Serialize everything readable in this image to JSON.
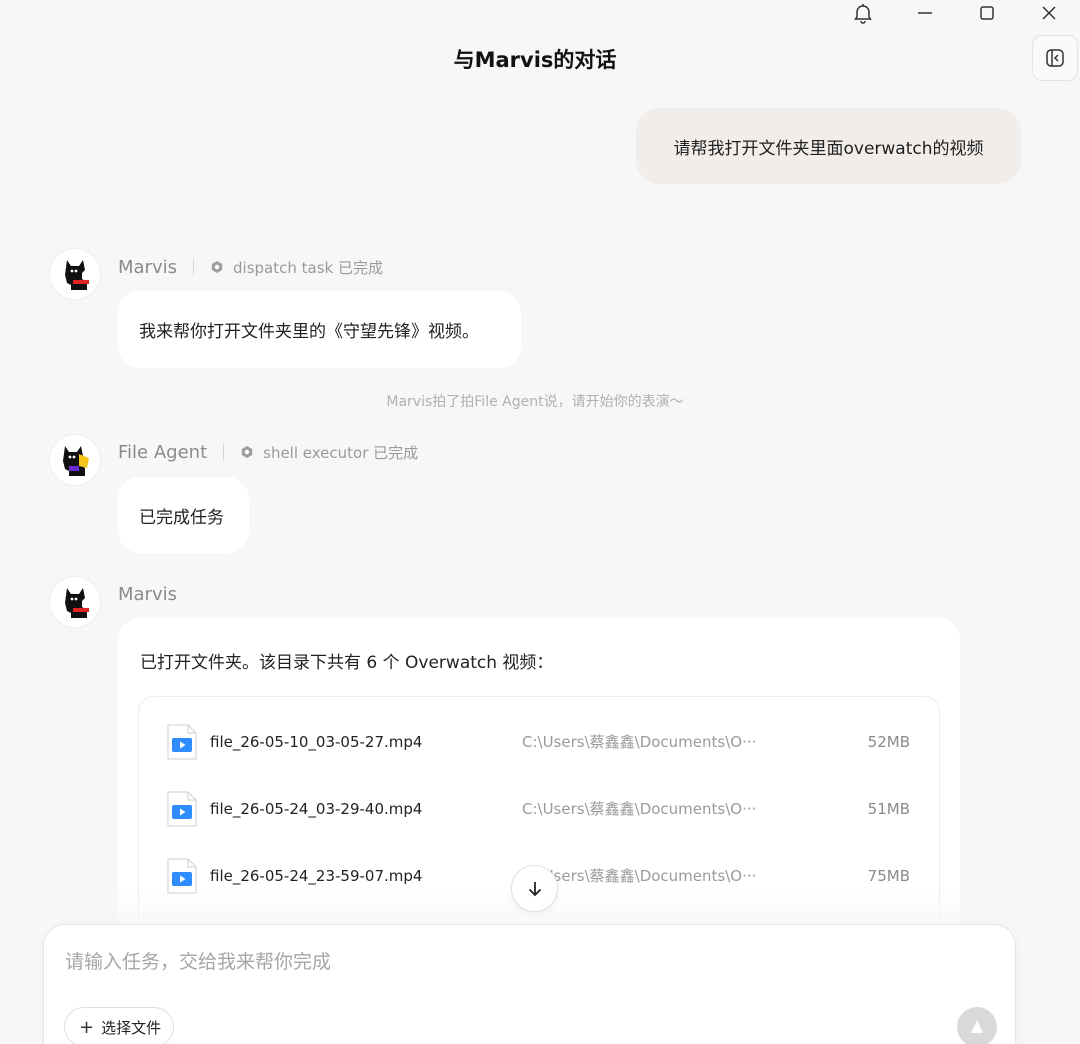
{
  "window": {
    "title": "与Marvis的对话"
  },
  "conversation": {
    "user_message": "请帮我打开文件夹里面overwatch的视频",
    "messages": [
      {
        "sender": "Marvis",
        "task_label": "dispatch task 已完成",
        "text": "我来帮你打开文件夹里的《守望先锋》视频。"
      },
      {
        "sender": "File Agent",
        "task_label": "shell executor 已完成",
        "text": "已完成任务"
      },
      {
        "sender": "Marvis",
        "text": "已打开文件夹。该目录下共有 6 个 Overwatch 视频："
      }
    ],
    "system_note": "Marvis拍了拍File Agent说，请开始你的表演～",
    "files": [
      {
        "name": "file_26-05-10_03-05-27.mp4",
        "path": "C:\\Users\\蔡鑫鑫\\Documents\\O···",
        "size": "52MB"
      },
      {
        "name": "file_26-05-24_03-29-40.mp4",
        "path": "C:\\Users\\蔡鑫鑫\\Documents\\O···",
        "size": "51MB"
      },
      {
        "name": "file_26-05-24_23-59-07.mp4",
        "path": "C:\\Users\\蔡鑫鑫\\Documents\\O···",
        "size": "75MB"
      }
    ]
  },
  "composer": {
    "placeholder": "请输入任务，交给我来帮你完成",
    "select_file_label": "选择文件"
  },
  "colors": {
    "background": "#f7f7f7",
    "user_bubble": "#f1edea",
    "file_icon_blue": "#2f8cff"
  }
}
